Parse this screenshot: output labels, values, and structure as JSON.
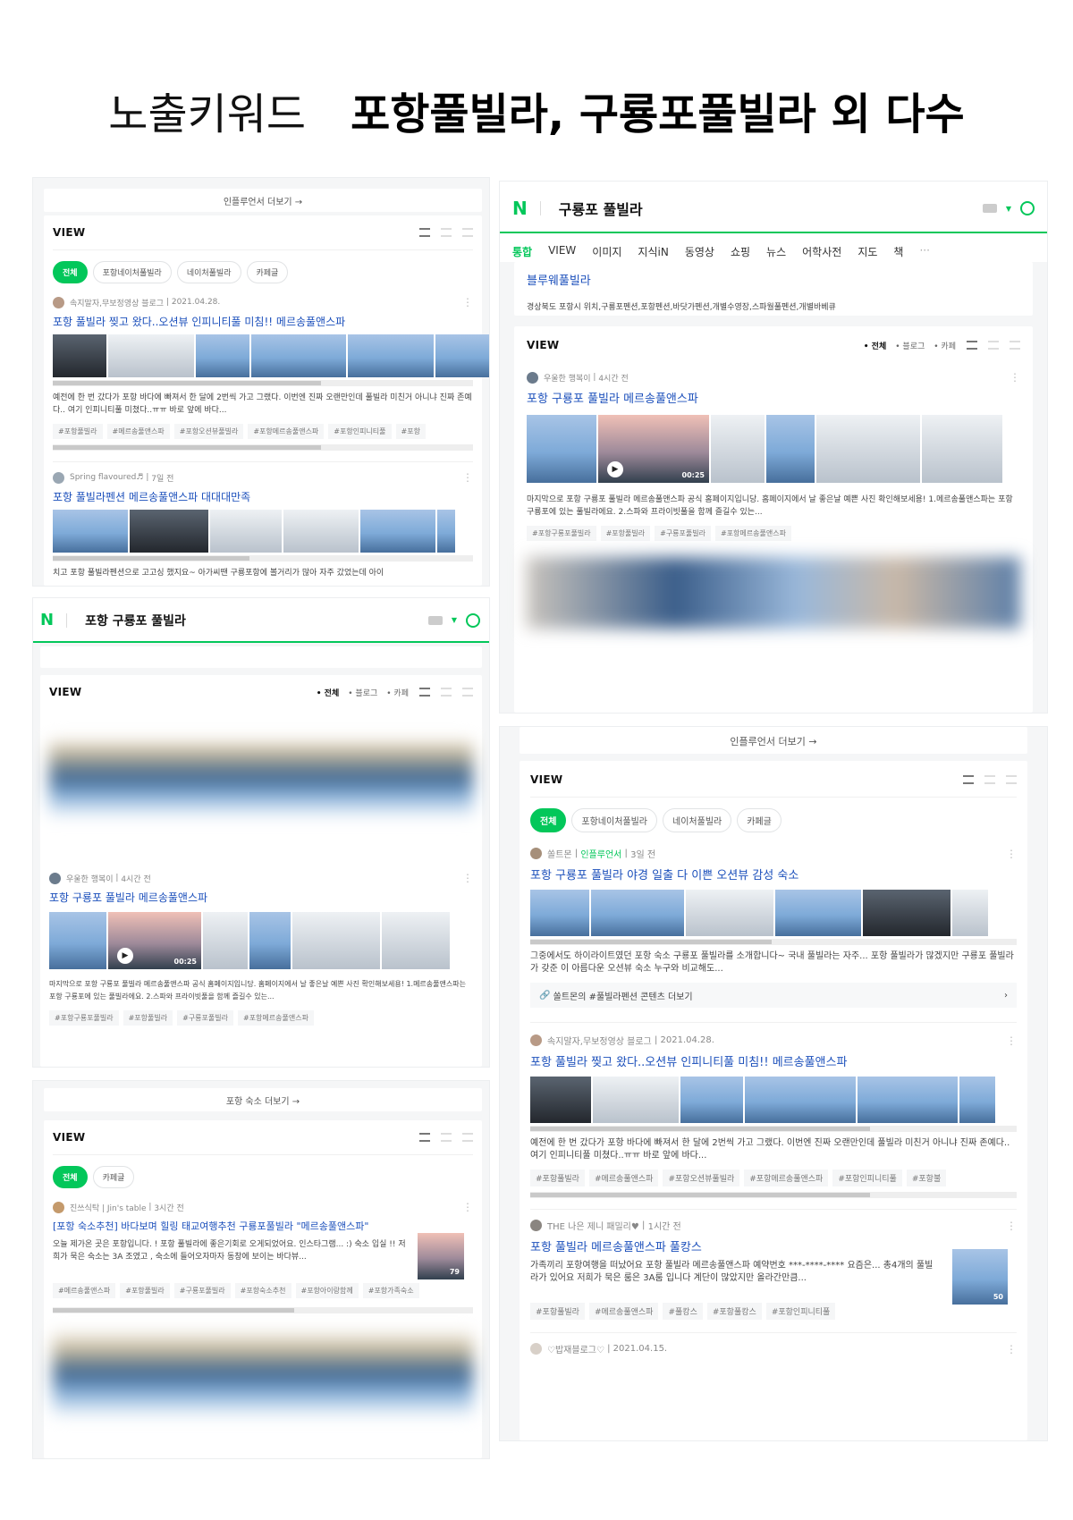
{
  "header": {
    "label": "노출키워드",
    "keywords": "포항풀빌라, 구룡포풀빌라 외 다수"
  },
  "shot1": {
    "more": "인플루언서 더보기 →",
    "view": "VIEW",
    "chips": [
      "전체",
      "포항네이처풀빌라",
      "네이처풀빌라",
      "카페글"
    ],
    "p1": {
      "author": "속지말자,무보정영상 블로그",
      "date": "2021.04.28.",
      "title": "포항 풀빌라 찢고 왔다..오션뷰 인피니티풀 미침!! 메르송풀앤스파",
      "desc": "예전에 한 번 갔다가 포항 바다에 빠져서 한 달에 2번씩 가고 그랬다. 이번엔 진짜 오랜만인데 풀빌라 미친거 아니냐 진짜 존예다.. 여기 인피니티풀 미쳤다..ㅠㅠ 바로 앞에 바다...",
      "tags": [
        "#포항풀빌라",
        "#메르송풀앤스파",
        "#포항오션뷰풀빌라",
        "#포항메르송풀앤스파",
        "#포항인피니티풀",
        "#포항"
      ]
    },
    "p2": {
      "author": "Spring flavoured♬",
      "date": "7일 전",
      "title": "포항 풀빌라펜션 메르송풀앤스파 대대대만족",
      "desc": "치고 포항 풀빌라펜션으로 고고싱 했지요~ 아가씨땐 구룡포항에 볼거리가 많아 자주 갔었는데 아이"
    }
  },
  "shot2": {
    "query": "구룡포 풀빌라",
    "tabs": [
      "통합",
      "VIEW",
      "이미지",
      "지식iN",
      "동영상",
      "쇼핑",
      "뉴스",
      "어학사전",
      "지도",
      "책",
      "···"
    ],
    "place": {
      "name": "블루웨풀빌라",
      "desc": "경상북도 포항시 위치,구룡포펜션,포항펜션,바닷가펜션,개별수영장,스파월풀펜션,개별바베큐"
    },
    "view": "VIEW",
    "filters": [
      "• 전체",
      "• 블로그",
      "• 카페"
    ],
    "post": {
      "author": "우울한 행복이",
      "date": "4시간 전",
      "title": "포항 구룡포 풀빌라 메르송풀앤스파",
      "duration": "00:25",
      "desc": "마지막으로 포항 구룡포 풀빌라 메르송풀앤스파 공식 홈페이지입니당. 홈페이지에서 날 좋은날 예쁜 사진 확인해보세용! 1.메르송풀앤스파는 포항 구룡포에 있는 풀빌라에요. 2.스파와 프라이빗풀을 함께 즐길수 있는...",
      "tags": [
        "#포항구룡포풀빌라",
        "#포항풀빌라",
        "#구룡포풀빌라",
        "#포항메르송풀앤스파"
      ]
    }
  },
  "shot3": {
    "query": "포항 구룡포 풀빌라",
    "view": "VIEW",
    "filters": [
      "• 전체",
      "• 블로그",
      "• 카페"
    ],
    "post": {
      "author": "우울한 행복이",
      "date": "4시간 전",
      "title": "포항 구룡포 풀빌라 메르송풀앤스파",
      "duration": "00:25",
      "desc": "마지막으로 포항 구룡포 풀빌라 메르송풀앤스파 공식 홈페이지입니당. 홈페이지에서 날 좋은날 예쁜 사진 확인해보세용! 1.메르송풀앤스파는 포항 구룡포에 있는 풀빌라에요. 2.스파와 프라이빗풀을 함께 즐길수 있는...",
      "tags": [
        "#포항구룡포풀빌라",
        "#포항풀빌라",
        "#구룡포풀빌라",
        "#포항메르송풀앤스파"
      ]
    }
  },
  "shot4": {
    "more": "포항 숙소 더보기 →",
    "view": "VIEW",
    "chips": [
      "전체",
      "카페글"
    ],
    "post": {
      "author": "진쓰식탁 | Jin's table",
      "date": "3시간 전",
      "title": "[포항 숙소추천] 바다보며 힐링 태교여행추천 구룡포풀빌라 \"메르송풀앤스파\"",
      "desc": "오늘 제가온 곳은 포항입니다. ! 포항 풀빌라에 좋은기회로 오게되었어요. 인스타그램... :) 숙소 입실 !! 저희가 묵은 숙소는 3A 조였고 , 숙소에 들어오자마자 동창에 보이는 바다뷰...",
      "thumb_count": "79",
      "tags": [
        "#메르송풀앤스파",
        "#포항풀빌라",
        "#구룡포풀빌라",
        "#포항숙소추천",
        "#포항아이랑함께",
        "#포항가족숙소"
      ]
    }
  },
  "shot5": {
    "more": "인플루언서 더보기 →",
    "view": "VIEW",
    "chips": [
      "전체",
      "포항네이처풀빌라",
      "네이처풀빌라",
      "카페글"
    ],
    "p1": {
      "author": "쏠트몬",
      "badge": "인플루언서",
      "date": "3일 전",
      "title": "포항 구룡포 풀빌라 야경 일출 다 이쁜 오션뷰 감성 숙소",
      "desc": "그중에서도 하이라이트였던 포항 숙소 구룡포 풀빌라를 소개합니다~ 국내 풀빌라는 자주... 포항 풀빌라가 많겠지만 구룡포 풀빌라가 갖준 이 아름다운 오션뷰 숙소 누구와 비교해도...",
      "link": "쏠트몬의 #풀빌라펜션 콘텐츠 더보기"
    },
    "p2": {
      "author": "속지말자,무보정영상 블로그",
      "date": "2021.04.28.",
      "title": "포항 풀빌라 찢고 왔다..오션뷰 인피니티풀 미침!! 메르송풀앤스파",
      "desc": "예전에 한 번 갔다가 포항 바다에 빠져서 한 달에 2번씩 가고 그랬다. 이번엔 진짜 오랜만인데 풀빌라 미친거 아니냐 진짜 존예다.. 여기 인피니티풀 미쳤다..ㅠㅠ 바로 앞에 바다...",
      "tags": [
        "#포항풀빌라",
        "#메르송풀앤스파",
        "#포항오션뷰풀빌라",
        "#포항메르송풀앤스파",
        "#포항인피니티풀",
        "#포항불"
      ]
    },
    "p3": {
      "author": "THE 나은 제니 패밀리♥",
      "date": "1시간 전",
      "title": "포항 풀빌라 메르송풀앤스파 풀캉스",
      "desc": "가족끼리 포항여행을 떠났어요 포항 풀빌라 메르송풀앤스파 예약번호 ***-****-**** 요즘은... 총4개의 풀빌라가 있어요 저희가 묵은 룸은 3A룸 입니다 계단이 많았지만 올라간만큼...",
      "thumb_count": "50",
      "tags": [
        "#포항풀빌라",
        "#메르송풀앤스파",
        "#풀캉스",
        "#포항풀캉스",
        "#포항인피니티풀"
      ]
    },
    "p4": {
      "author": "♡밥재블로그♡",
      "date": "2021.04.15."
    }
  }
}
